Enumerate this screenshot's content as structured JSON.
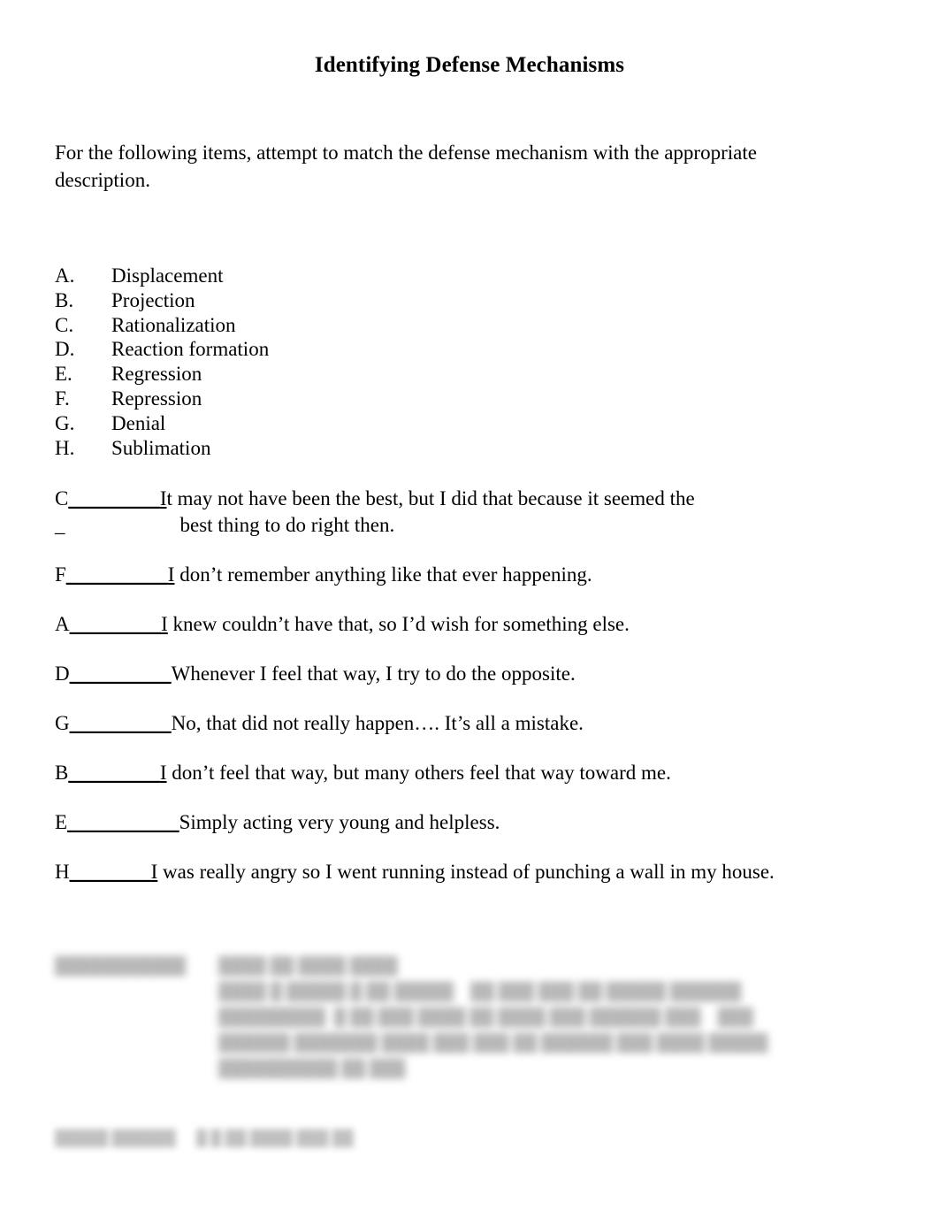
{
  "document": {
    "title": "Identifying Defense Mechanisms",
    "intro": "For the following items, attempt to match the defense mechanism with the appropriate description."
  },
  "mechanism_list": [
    {
      "letter": "A.",
      "label": "Displacement"
    },
    {
      "letter": "B.",
      "label": "Projection"
    },
    {
      "letter": "C.",
      "label": "Rationalization"
    },
    {
      "letter": "D.",
      "label": "Reaction formation"
    },
    {
      "letter": "E.",
      "label": "Regression"
    },
    {
      "letter": "F.",
      "label": "Repression"
    },
    {
      "letter": "G.",
      "label": "Denial"
    },
    {
      "letter": "H.",
      "label": "Sublimation"
    }
  ],
  "answers": [
    {
      "answer_letter": "C",
      "blank": "_________",
      "lead_underlined": "I",
      "text": "t may not have been the best, but I did that because it seemed the",
      "continuation_marker": "_",
      "continuation_text": "best thing to do right then."
    },
    {
      "answer_letter": "F",
      "blank": "__________",
      "lead_underlined": "I",
      "text": " don’t remember anything like that ever happening.",
      "continuation_marker": "",
      "continuation_text": ""
    },
    {
      "answer_letter": "A",
      "blank": "_________",
      "lead_underlined": "I",
      "text": " knew couldn’t have that, so I’d wish for something else.",
      "continuation_marker": "",
      "continuation_text": ""
    },
    {
      "answer_letter": "D",
      "blank": "__________",
      "lead_underlined": "",
      "text": "Whenever I feel that way, I try to do the opposite.",
      "continuation_marker": "",
      "continuation_text": ""
    },
    {
      "answer_letter": "G",
      "blank": "__________",
      "lead_underlined": "",
      "text": "No, that did not really happen…. It’s all a mistake.",
      "continuation_marker": "",
      "continuation_text": ""
    },
    {
      "answer_letter": "B",
      "blank": "_________",
      "lead_underlined": "I",
      "text": " don’t feel that way, but many others feel that way toward me.",
      "continuation_marker": "",
      "continuation_text": ""
    },
    {
      "answer_letter": "E",
      "blank": "___________",
      "lead_underlined": "",
      "text": "Simply acting very young and helpless.",
      "continuation_marker": "",
      "continuation_text": ""
    },
    {
      "answer_letter": "H",
      "blank": "________",
      "lead_underlined": "I",
      "text": " was really angry so I went running instead of punching a wall in my house.",
      "continuation_marker": "",
      "continuation_text": ""
    }
  ],
  "illegible_block": {
    "note": "illegible",
    "label": "███████████",
    "lines": [
      "████ ██ ████ ████",
      "████ █ █████ █ ██ █████    ██ ███ ███ ██ █████ ██████",
      "█████████  █ ██ ███ ████ ██ ████ ███ ██████ ███    ███",
      "██████ ███████ ████ ███ ███ ██ ██████ ███ ████ █████",
      "██████████ ██ ███"
    ]
  },
  "illegible_footer": {
    "note": "illegible",
    "label": "█████ ██████",
    "value": "█ █ ██ ████ ███ ██"
  }
}
